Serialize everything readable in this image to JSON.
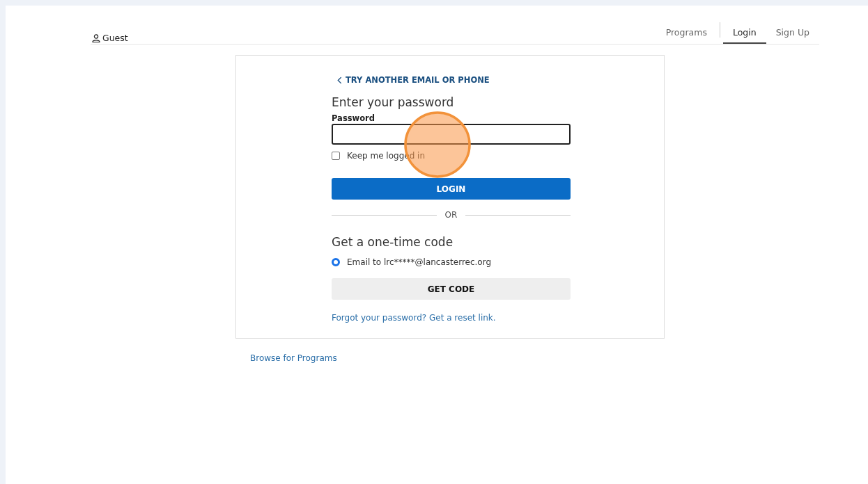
{
  "header": {
    "user": "Guest",
    "nav": [
      {
        "label": "Programs",
        "selected": false
      },
      {
        "label": "Login",
        "selected": true
      },
      {
        "label": "Sign Up",
        "selected": false
      }
    ]
  },
  "card": {
    "back_link": "TRY ANOTHER EMAIL OR PHONE",
    "title": "Enter your password",
    "password": {
      "label": "Password"
    },
    "keep_logged_in": {
      "label": "Keep me logged in",
      "checked": false
    },
    "login_button": "LOGIN",
    "divider": "OR",
    "code_title": "Get a one-time code",
    "code_options": [
      {
        "label": "Email to lrc*****@lancasterrec.org",
        "selected": true
      }
    ],
    "code_button": "GET CODE",
    "reset_link": "Forgot your password? Get a reset link."
  },
  "footer_link": "Browse for Programs"
}
